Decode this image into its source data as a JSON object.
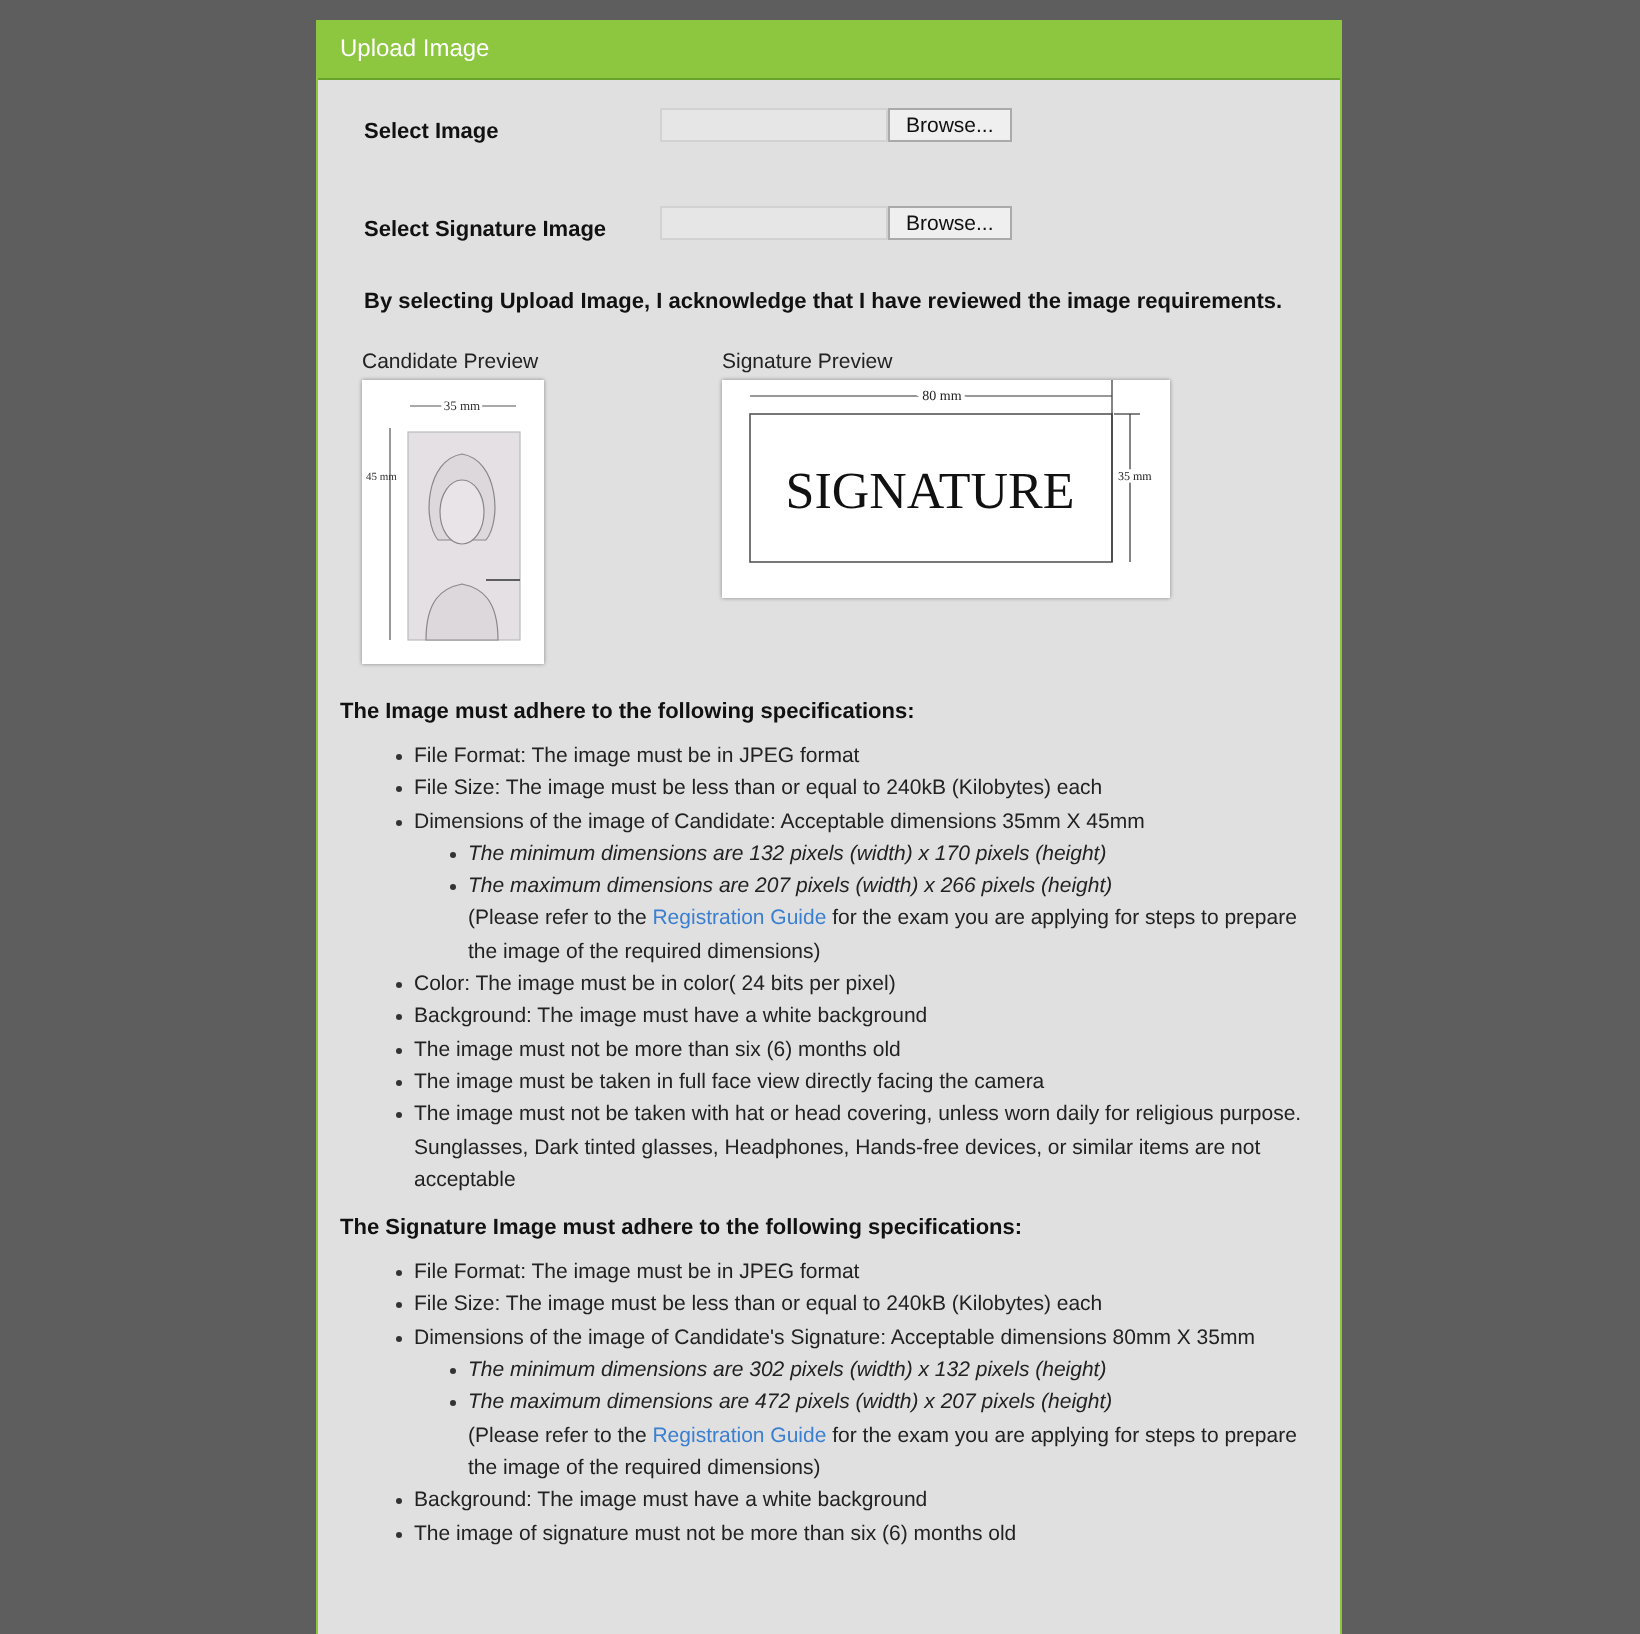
{
  "panel": {
    "title": "Upload Image"
  },
  "upload_fields": [
    {
      "label": "Select Image",
      "button": "Browse..."
    },
    {
      "label": "Select Signature Image",
      "button": "Browse..."
    }
  ],
  "acknowledgement": "By selecting Upload Image, I acknowledge that I have reviewed the image requirements.",
  "previews": [
    {
      "kind": "photo",
      "label": "Candidate Preview",
      "width_label": "35 mm",
      "height_label": "45 mm"
    },
    {
      "kind": "signature",
      "label": "Signature Preview",
      "width_label": "80 mm",
      "height_label": "35 mm",
      "sample_text": "SIGNATURE"
    }
  ],
  "spec_sections": [
    {
      "heading": "The Image must adhere to the following specifications:",
      "items": [
        {
          "text": "File Format: The image must be in JPEG format"
        },
        {
          "text": "File Size: The image must be less than or equal to 240kB (Kilobytes) each"
        },
        {
          "text": "Dimensions of the image of Candidate: Acceptable dimensions 35mm X 45mm",
          "sub_items": [
            "The minimum dimensions are 132 pixels (width) x 170 pixels (height)",
            "The maximum dimensions are 207 pixels (width) x 266 pixels (height)"
          ],
          "note": {
            "before": "(Please refer to the",
            "link": "Registration Guide",
            "after": "for the exam you are applying for steps to prepare the image of the required dimensions)"
          }
        },
        {
          "text": "Color: The image must be in color( 24 bits per pixel)"
        },
        {
          "text": "Background: The image must have a white background"
        },
        {
          "text": "The image must not be more than six (6) months old"
        },
        {
          "text": "The image must be taken in full face view directly facing the camera"
        },
        {
          "text": "The image must not be taken with hat or head covering, unless worn daily for religious purpose. Sunglasses, Dark tinted glasses, Headphones, Hands-free devices, or similar items are not acceptable"
        }
      ]
    },
    {
      "heading": "The Signature Image must adhere to the following specifications:",
      "items": [
        {
          "text": "File Format: The image must be in JPEG format"
        },
        {
          "text": "File Size: The image must be less than or equal to 240kB (Kilobytes) each"
        },
        {
          "text": "Dimensions of the image of Candidate's Signature: Acceptable dimensions 80mm X 35mm",
          "sub_items": [
            "The minimum dimensions are 302 pixels (width) x 132 pixels (height)",
            "The maximum dimensions are 472 pixels (width) x 207 pixels (height)"
          ],
          "note": {
            "before": "(Please refer to the",
            "link": "Registration Guide",
            "after": "for the exam you are applying for steps to prepare the image of the required dimensions)"
          }
        },
        {
          "text": "Background: The image must have a white background"
        },
        {
          "text": "The image of signature must not be more than six (6) months old"
        }
      ]
    }
  ]
}
